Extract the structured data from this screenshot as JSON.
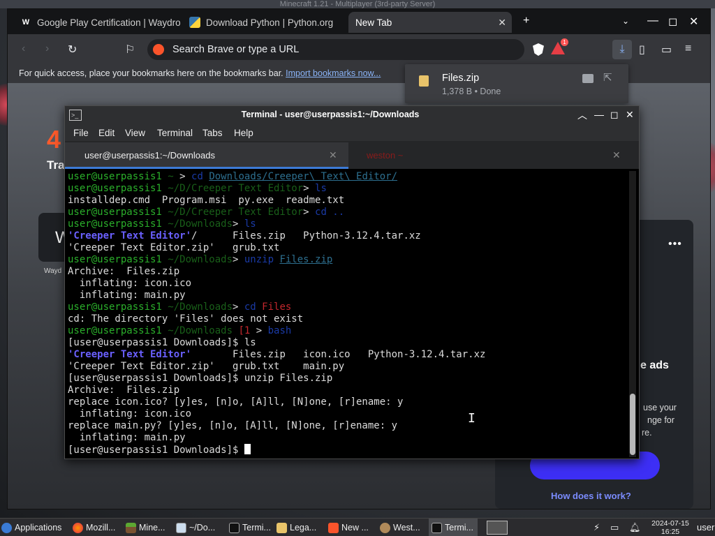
{
  "system": {
    "top_title": "Minecraft 1.21 - Multiplayer (3rd-party Server)"
  },
  "browser": {
    "tabs": [
      {
        "label": "Google Play Certification | Waydro",
        "favicon": "W"
      },
      {
        "label": "Download Python | Python.org",
        "favicon": "py"
      },
      {
        "label": "New Tab",
        "favicon": ""
      }
    ],
    "new_tab_symbol": "+",
    "omnibox_placeholder": "Search Brave or type a URL",
    "rewards_count": "1",
    "bookmarks_message": "For quick access, place your bookmarks here on the bookmarks bar.",
    "bookmarks_link": "Import bookmarks now...",
    "page": {
      "partial_heading": "4",
      "partial_subheading": "Tra",
      "partial_card_letter": "W",
      "partial_card_caption": "Wayd",
      "partial_ads": "e ads",
      "partial_text_1": "use your",
      "partial_text_2": "nge for",
      "partial_text_3": "re.",
      "how_link": "How does it work?"
    }
  },
  "download": {
    "filename": "Files.zip",
    "status": "1,378 B • Done"
  },
  "terminal": {
    "title": "Terminal - user@userpassis1:~/Downloads",
    "menu": [
      "File",
      "Edit",
      "View",
      "Terminal",
      "Tabs",
      "Help"
    ],
    "tabs": [
      {
        "label": "user@userpassis1:~/Downloads"
      },
      {
        "label": "weston ~"
      }
    ],
    "lines": [
      [
        {
          "t": "user@userpassis1",
          "c": "green"
        },
        {
          "t": " ~ ",
          "c": "dim"
        },
        {
          "t": "> ",
          "c": "white"
        },
        {
          "t": "cd ",
          "c": "blue"
        },
        {
          "t": "Downloads/Creeper\\ Text\\ Editor/",
          "c": "link"
        }
      ],
      [
        {
          "t": "user@userpassis1",
          "c": "green"
        },
        {
          "t": " ~/D/Creeper Text Editor",
          "c": "dim"
        },
        {
          "t": "> ",
          "c": "white"
        },
        {
          "t": "ls",
          "c": "blue"
        }
      ],
      [
        {
          "t": "installdep.cmd  Program.msi  py.exe  readme.txt",
          "c": "white"
        }
      ],
      [
        {
          "t": "user@userpassis1",
          "c": "green"
        },
        {
          "t": " ~/D/Creeper Text Editor",
          "c": "dim"
        },
        {
          "t": "> ",
          "c": "white"
        },
        {
          "t": "cd ..",
          "c": "blue"
        }
      ],
      [
        {
          "t": "user@userpassis1",
          "c": "green"
        },
        {
          "t": " ~/Downloads",
          "c": "dim"
        },
        {
          "t": "> ",
          "c": "white"
        },
        {
          "t": "ls",
          "c": "blue"
        }
      ],
      [
        {
          "t": "'Creeper Text Editor'",
          "c": "bold"
        },
        {
          "t": "/      Files.zip   Python-3.12.4.tar.xz",
          "c": "white"
        }
      ],
      [
        {
          "t": "'Creeper Text Editor.zip'   grub.txt",
          "c": "white"
        }
      ],
      [
        {
          "t": "user@userpassis1",
          "c": "green"
        },
        {
          "t": " ~/Downloads",
          "c": "dim"
        },
        {
          "t": "> ",
          "c": "white"
        },
        {
          "t": "unzip ",
          "c": "blue"
        },
        {
          "t": "Files.zip",
          "c": "link"
        }
      ],
      [
        {
          "t": "Archive:  Files.zip",
          "c": "white"
        }
      ],
      [
        {
          "t": "  inflating: icon.ico",
          "c": "white"
        }
      ],
      [
        {
          "t": "  inflating: main.py",
          "c": "white"
        }
      ],
      [
        {
          "t": "user@userpassis1",
          "c": "green"
        },
        {
          "t": " ~/Downloads",
          "c": "dim"
        },
        {
          "t": "> ",
          "c": "white"
        },
        {
          "t": "cd ",
          "c": "blue"
        },
        {
          "t": "Files",
          "c": "red"
        }
      ],
      [
        {
          "t": "cd: The directory 'Files' does not exist",
          "c": "white"
        }
      ],
      [
        {
          "t": "user@userpassis1",
          "c": "green"
        },
        {
          "t": " ~/Downloads ",
          "c": "dim"
        },
        {
          "t": "[1",
          "c": "red"
        },
        {
          "t": " > ",
          "c": "white"
        },
        {
          "t": "bash",
          "c": "blue"
        }
      ],
      [
        {
          "t": "[user@userpassis1 Downloads]$ ls",
          "c": "white"
        }
      ],
      [
        {
          "t": "'Creeper Text Editor'",
          "c": "bold"
        },
        {
          "t": "       Files.zip   icon.ico   Python-3.12.4.tar.xz",
          "c": "white"
        }
      ],
      [
        {
          "t": "'Creeper Text Editor.zip'   grub.txt    main.py",
          "c": "white"
        }
      ],
      [
        {
          "t": "[user@userpassis1 Downloads]$ unzip Files.zip",
          "c": "white"
        }
      ],
      [
        {
          "t": "Archive:  Files.zip",
          "c": "white"
        }
      ],
      [
        {
          "t": "replace icon.ico? [y]es, [n]o, [A]ll, [N]one, [r]ename: y",
          "c": "white"
        }
      ],
      [
        {
          "t": "  inflating: icon.ico",
          "c": "white"
        }
      ],
      [
        {
          "t": "replace main.py? [y]es, [n]o, [A]ll, [N]one, [r]ename: y",
          "c": "white"
        }
      ],
      [
        {
          "t": "  inflating: main.py",
          "c": "white"
        }
      ],
      [
        {
          "t": "[user@userpassis1 Downloads]$ ",
          "c": "white"
        }
      ]
    ]
  },
  "taskbar": {
    "applications": "Applications",
    "items": [
      {
        "label": "Mozill...",
        "icon": "firefox-icon"
      },
      {
        "label": "Mine...",
        "icon": "minecraft-icon"
      },
      {
        "label": "~/Do...",
        "icon": "editor-icon"
      },
      {
        "label": "Termi...",
        "icon": "terminal-icon"
      },
      {
        "label": "Lega...",
        "icon": "folder-icon"
      },
      {
        "label": "New ...",
        "icon": "brave-icon"
      },
      {
        "label": "West...",
        "icon": "weston-icon"
      },
      {
        "label": "Termi...",
        "icon": "terminal-icon"
      }
    ],
    "terminal_group_count": "3",
    "date": "2024-07-15",
    "time": "16:25",
    "user": "user"
  },
  "colors": {
    "accent": "#3d7bd6",
    "prompt_green": "#2bb02b",
    "error_red": "#c2272d"
  }
}
